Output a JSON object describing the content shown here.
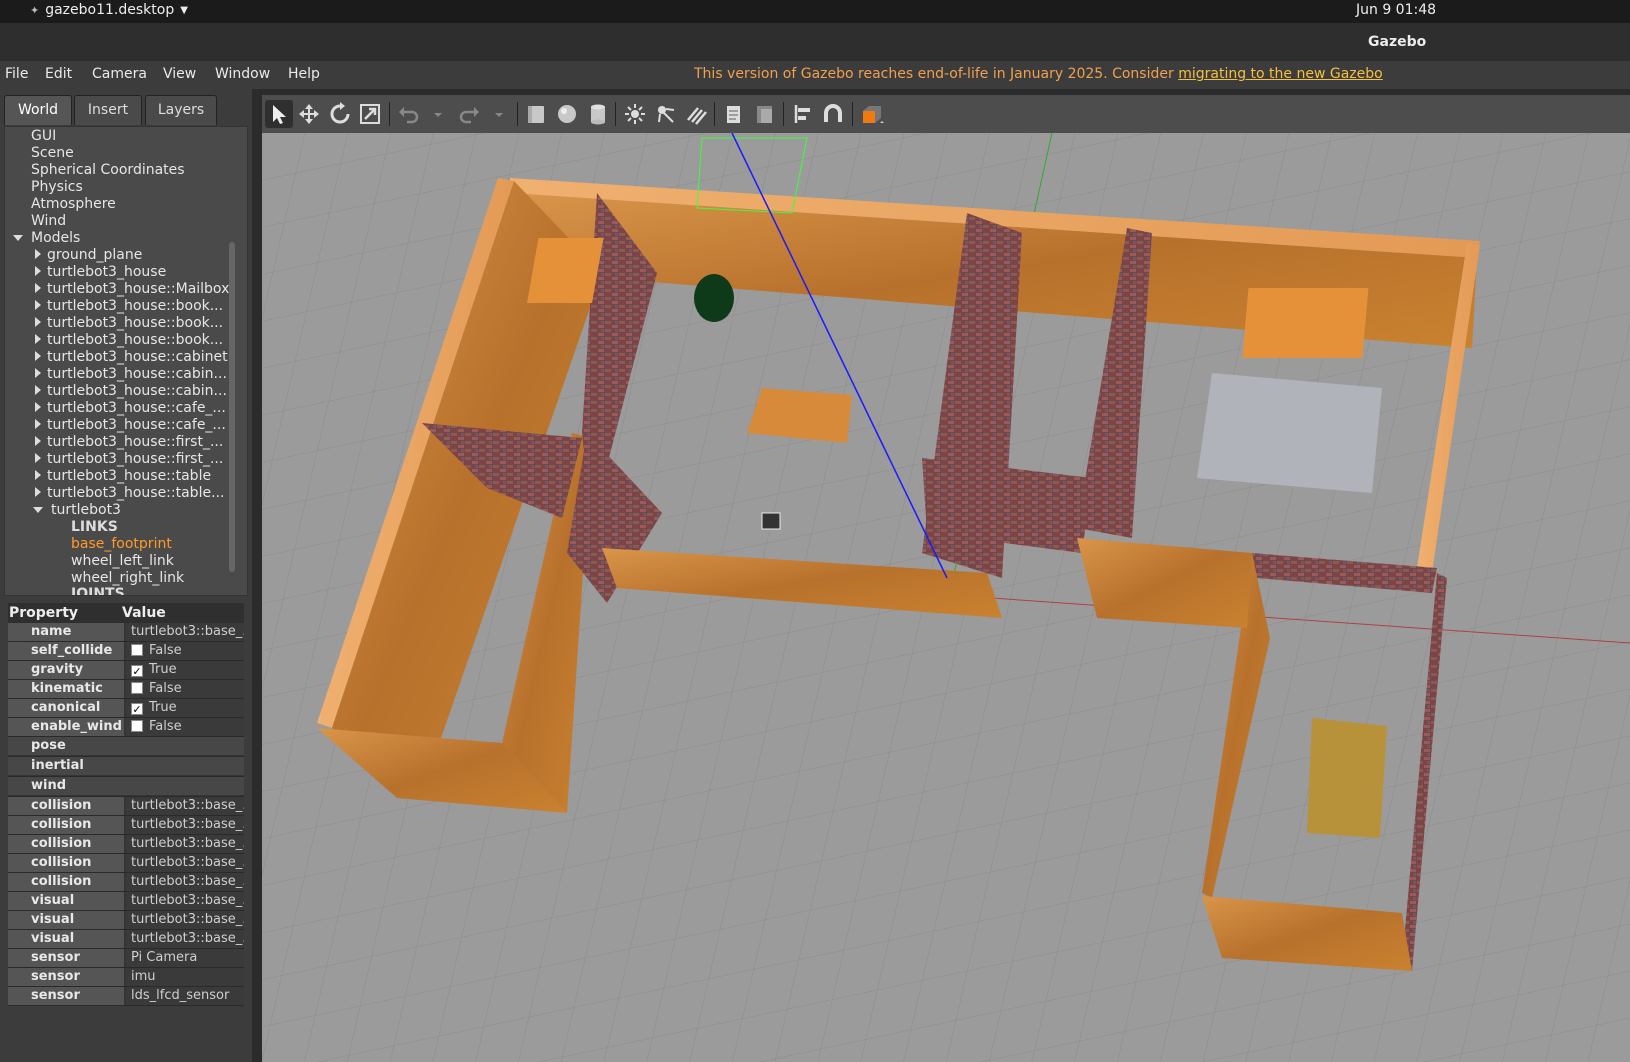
{
  "system": {
    "app_menu": "gazebo11.desktop",
    "clock": "Jun 9  01:48"
  },
  "window": {
    "title": "Gazebo"
  },
  "menu": [
    "File",
    "Edit",
    "Camera",
    "View",
    "Window",
    "Help"
  ],
  "notice": {
    "text": "This version of Gazebo reaches end-of-life in January 2025. Consider ",
    "link": "migrating to the new Gazebo"
  },
  "tabs": [
    "World",
    "Insert",
    "Layers"
  ],
  "tree": {
    "top": [
      "GUI",
      "Scene",
      "Spherical Coordinates",
      "Physics",
      "Atmosphere",
      "Wind"
    ],
    "models_label": "Models",
    "models": [
      "ground_plane",
      "turtlebot3_house",
      "turtlebot3_house::Mailbox",
      "turtlebot3_house::book...",
      "turtlebot3_house::book...",
      "turtlebot3_house::book...",
      "turtlebot3_house::cabinet",
      "turtlebot3_house::cabin...",
      "turtlebot3_house::cabin...",
      "turtlebot3_house::cafe_...",
      "turtlebot3_house::cafe_...",
      "turtlebot3_house::first_...",
      "turtlebot3_house::first_...",
      "turtlebot3_house::table",
      "turtlebot3_house::table..."
    ],
    "expanded_model": "turtlebot3",
    "links_label": "LINKS",
    "links": [
      "base_footprint",
      "wheel_left_link",
      "wheel_right_link"
    ],
    "joints_label": "JOINTS"
  },
  "properties": {
    "header": {
      "property": "Property",
      "value": "Value"
    },
    "rows": [
      {
        "key": "name",
        "value": "turtlebot3::base_..."
      },
      {
        "key": "self_collide",
        "value": "False",
        "checked": false
      },
      {
        "key": "gravity",
        "value": "True",
        "checked": true
      },
      {
        "key": "kinematic",
        "value": "False",
        "checked": false
      },
      {
        "key": "canonical",
        "value": "True",
        "checked": true
      },
      {
        "key": "enable_wind",
        "value": "False",
        "checked": false
      }
    ],
    "groups": [
      "pose",
      "inertial",
      "wind"
    ],
    "children": [
      {
        "key": "collision",
        "value": "turtlebot3::base_..."
      },
      {
        "key": "collision",
        "value": "turtlebot3::base_..."
      },
      {
        "key": "collision",
        "value": "turtlebot3::base_..."
      },
      {
        "key": "collision",
        "value": "turtlebot3::base_..."
      },
      {
        "key": "collision",
        "value": "turtlebot3::base_..."
      },
      {
        "key": "visual",
        "value": "turtlebot3::base_..."
      },
      {
        "key": "visual",
        "value": "turtlebot3::base_..."
      },
      {
        "key": "visual",
        "value": "turtlebot3::base_..."
      }
    ],
    "sensors": [
      {
        "key": "sensor",
        "value": "Pi Camera"
      },
      {
        "key": "sensor",
        "value": "imu"
      },
      {
        "key": "sensor",
        "value": "lds_lfcd_sensor"
      }
    ]
  },
  "toolbar": [
    "select-icon",
    "translate-icon",
    "rotate-icon",
    "scale-icon",
    "undo-icon",
    "undo-history-icon",
    "redo-icon",
    "redo-history-icon",
    "box-icon",
    "sphere-icon",
    "cylinder-icon",
    "point-light-icon",
    "spot-light-icon",
    "directional-light-icon",
    "copy-icon",
    "paste-icon",
    "align-icon",
    "snap-icon",
    "view-angle-icon"
  ],
  "colors": {
    "accent": "#ff9a2a",
    "notice": "#f0a050",
    "link": "#f5c040",
    "wood": "#c9822f",
    "brick": "#8a4a4a",
    "ground": "#9a9a9a"
  }
}
